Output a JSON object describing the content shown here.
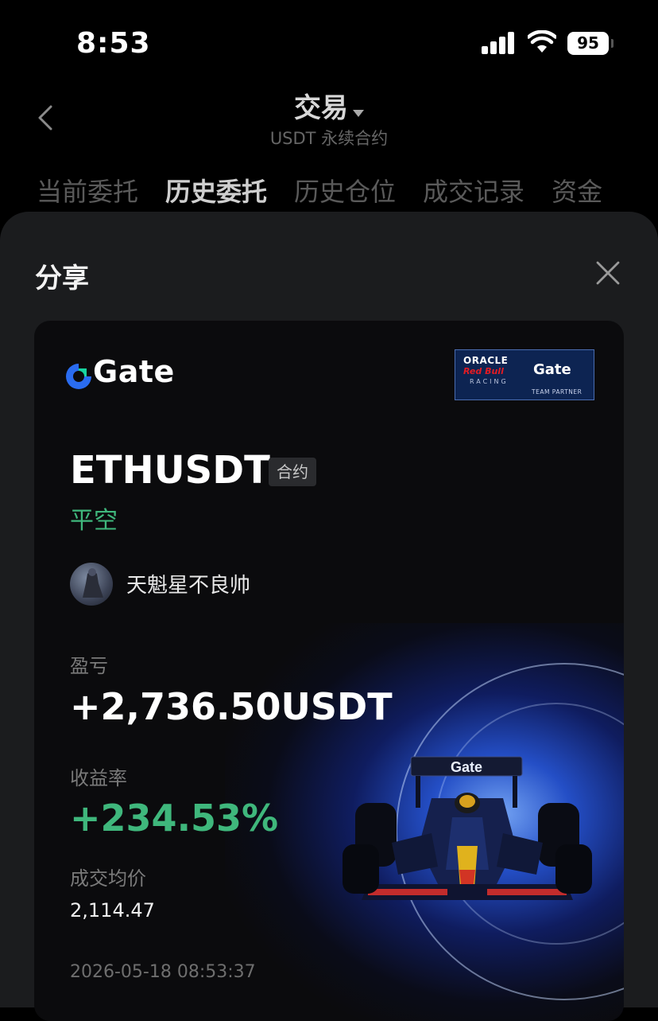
{
  "status_bar": {
    "time": "8:53",
    "battery": "95"
  },
  "header": {
    "title": "交易",
    "subtitle": "USDT 永续合约"
  },
  "tabs": [
    "当前委托",
    "历史委托",
    "历史仓位",
    "成交记录",
    "资金"
  ],
  "share": {
    "title": "分享",
    "card": {
      "logo": "Gate",
      "partner": {
        "oracle": "ORACLE",
        "redbull": "Red Bull",
        "racing": "RACING",
        "gate": "Gate",
        "team": "TEAM PARTNER"
      },
      "symbol": "ETHUSDT",
      "contract_badge": "合约",
      "side": "平空",
      "nickname": "天魁星不良帅",
      "pnl_label": "盈亏",
      "pnl_value": "+2,736.50USDT",
      "roi_label": "收益率",
      "roi_value": "+234.53%",
      "avg_price_label": "成交均价",
      "avg_price_value": "2,114.47",
      "timestamp": "2026-05-18 08:53:37",
      "car_livery": "Gate"
    }
  },
  "colors": {
    "accent_green": "#3fb77c",
    "gate_blue": "#2a6cf0",
    "sheet_bg": "#1b1c1e"
  }
}
